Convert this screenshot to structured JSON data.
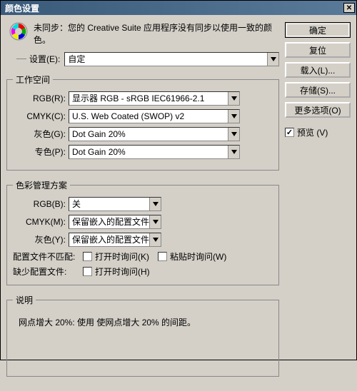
{
  "window": {
    "title": "颜色设置"
  },
  "buttons": {
    "ok": "确定",
    "reset": "复位",
    "load": "载入(L)...",
    "save": "存储(S)...",
    "more": "更多选项(O)"
  },
  "warning": {
    "text": "未同步：您的 Creative Suite 应用程序没有同步以使用一致的颜色。"
  },
  "settings": {
    "label": "设置(E):",
    "value": "自定"
  },
  "workspace": {
    "legend": "工作空间",
    "rgb_label": "RGB(R):",
    "rgb_value": "显示器 RGB - sRGB IEC61966-2.1",
    "cmyk_label": "CMYK(C):",
    "cmyk_value": "U.S. Web Coated (SWOP) v2",
    "gray_label": "灰色(G):",
    "gray_value": "Dot Gain 20%",
    "spot_label": "专色(P):",
    "spot_value": "Dot Gain 20%"
  },
  "policy": {
    "legend": "色彩管理方案",
    "rgb_label": "RGB(B):",
    "rgb_value": "关",
    "cmyk_label": "CMYK(M):",
    "cmyk_value": "保留嵌入的配置文件",
    "gray_label": "灰色(Y):",
    "gray_value": "保留嵌入的配置文件",
    "mismatch_label": "配置文件不匹配:",
    "ask_open": "打开时询问(K)",
    "ask_paste": "粘贴时询问(W)",
    "missing_label": "缺少配置文件:",
    "ask_open2": "打开时询问(H)"
  },
  "desc": {
    "legend": "说明",
    "text": "网点增大 20%: 使用 使网点增大 20% 的间距。"
  },
  "preview": {
    "label": "预览 (V)"
  }
}
